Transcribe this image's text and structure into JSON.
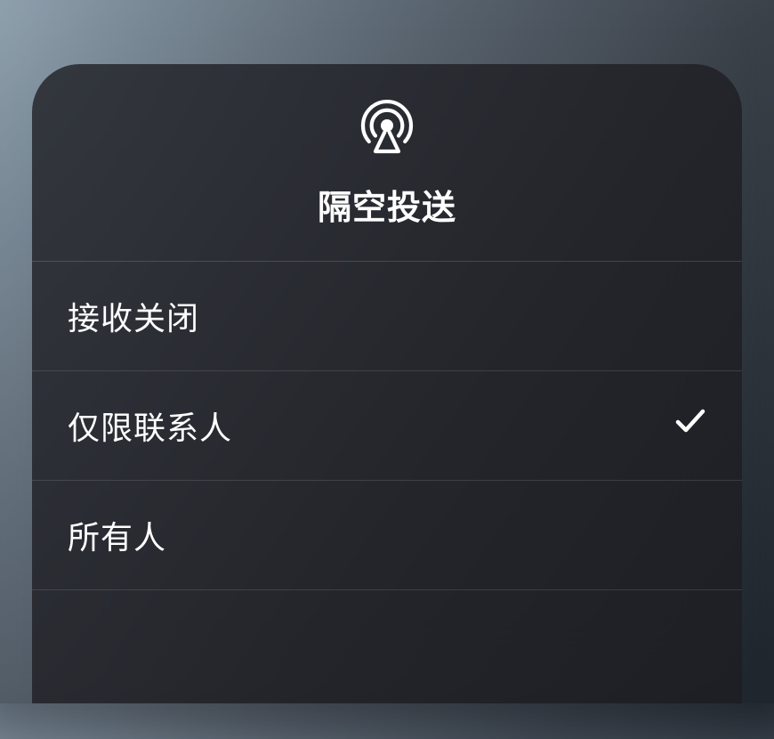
{
  "header": {
    "title": "隔空投送"
  },
  "options": [
    {
      "label": "接收关闭",
      "selected": false
    },
    {
      "label": "仅限联系人",
      "selected": true
    },
    {
      "label": "所有人",
      "selected": false
    }
  ]
}
